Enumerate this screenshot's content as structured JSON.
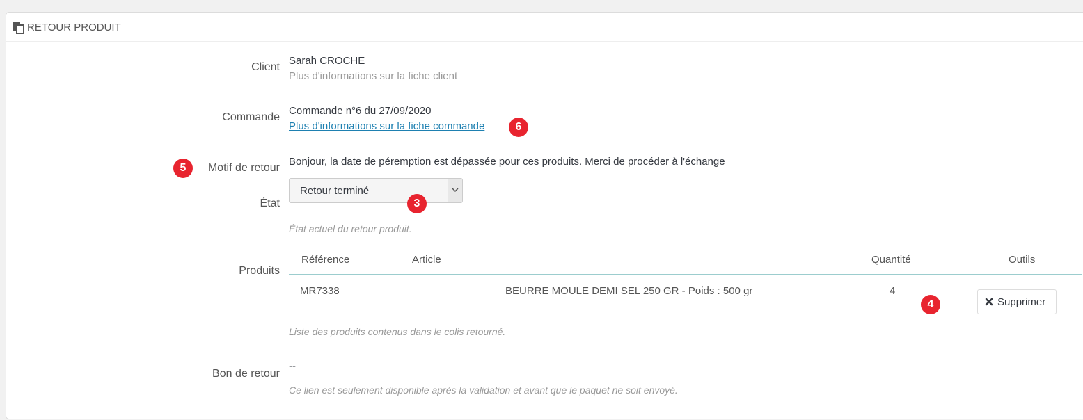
{
  "panel": {
    "title": "RETOUR PRODUIT"
  },
  "client": {
    "label": "Client",
    "name": "Sarah CROCHE",
    "info": "Plus d'informations sur la fiche client"
  },
  "order": {
    "label": "Commande",
    "value": "Commande n°6 du 27/09/2020",
    "link": "Plus d'informations sur la fiche commande"
  },
  "reason": {
    "label": "Motif de retour",
    "value": "Bonjour, la date de péremption est dépassée pour ces produits. Merci de procéder à l'échange"
  },
  "state": {
    "label": "État",
    "selected": "Retour terminé",
    "help": "État actuel du retour produit."
  },
  "products": {
    "label": "Produits",
    "columns": {
      "reference": "Référence",
      "article": "Article",
      "quantity": "Quantité",
      "tools": "Outils"
    },
    "rows": [
      {
        "reference": "MR7338",
        "article": "BEURRE MOULE DEMI SEL 250 GR - Poids : 500 gr",
        "quantity": "4",
        "action": "Supprimer"
      }
    ],
    "help": "Liste des produits contenus dans le colis retourné."
  },
  "voucher": {
    "label": "Bon de retour",
    "value": "--",
    "help": "Ce lien est seulement disponible après la validation et avant que le paquet ne soit envoyé."
  },
  "badges": {
    "order_link": "6",
    "reason": "5",
    "state": "3",
    "quantity": "4"
  },
  "colors": {
    "badge": "#e8242f",
    "link": "#1e80b1",
    "table_header_border": "#9ccdce"
  }
}
